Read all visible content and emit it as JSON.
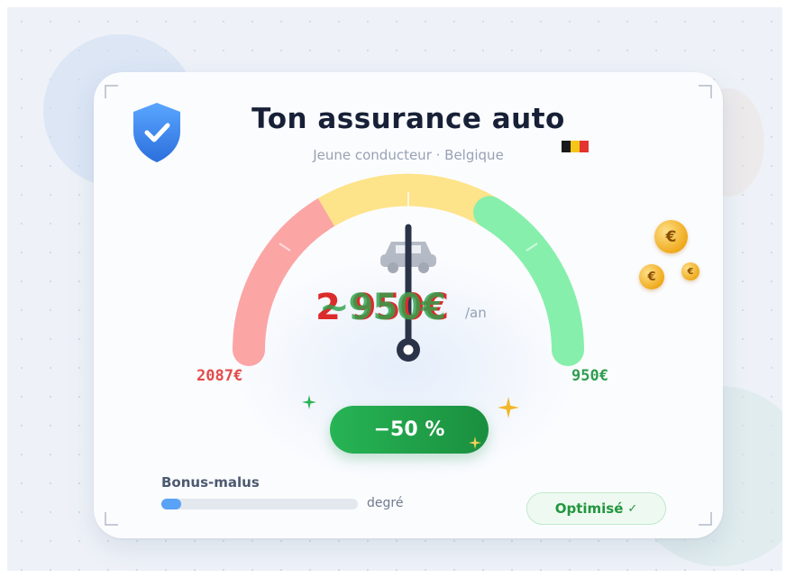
{
  "header": {
    "title": "Ton assurance auto",
    "subtitle": "Jeune conducteur · Belgique"
  },
  "gauge": {
    "max_label": "2087€",
    "min_label": "950€",
    "price_before": "2 950€",
    "price_after": "~950€",
    "unit": "/an",
    "segment_colors": [
      "#fca5a5",
      "#fde38a",
      "#86efac"
    ]
  },
  "discount": {
    "label": "−50 %"
  },
  "bonus_malus": {
    "label": "Bonus-malus",
    "unit": "degré",
    "level_fraction": 0.1
  },
  "status": {
    "label": "Optimisé",
    "check": "✓"
  },
  "coins": {
    "symbol": "€"
  },
  "icons": [
    "shield-check-icon",
    "belgium-flag-icon",
    "car-icon",
    "sparkle-icon",
    "coin-icon"
  ],
  "flag_colors": [
    "#1a1a1a",
    "#f5c518",
    "#e3342f"
  ]
}
